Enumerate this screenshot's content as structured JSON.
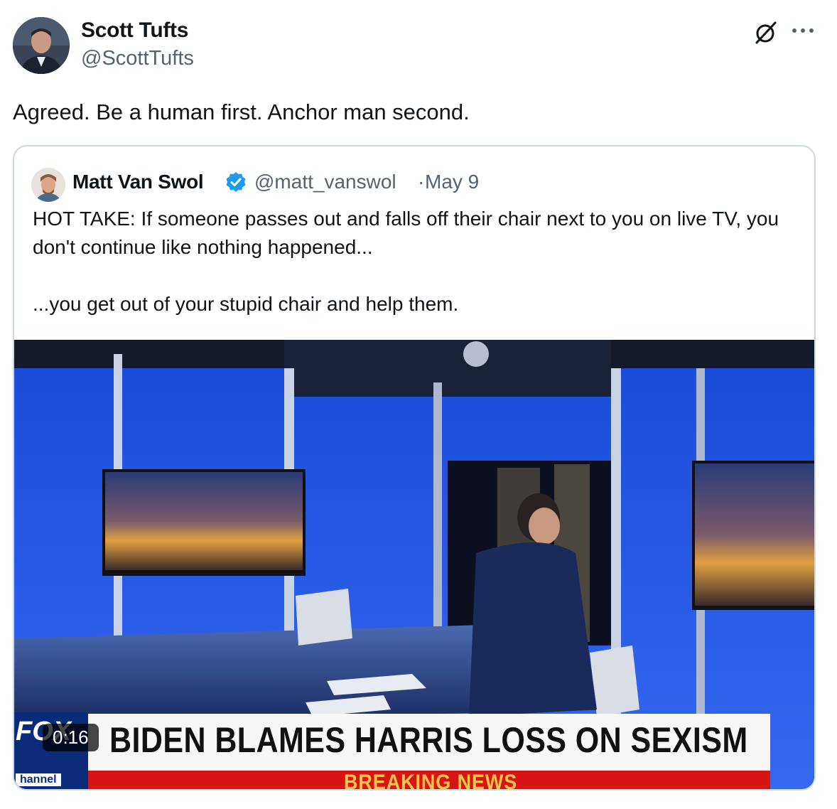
{
  "tweet": {
    "author_name": "Scott Tufts",
    "author_handle": "@ScottTufts",
    "text": "Agreed. Be a human first. Anchor man second.",
    "icons": {
      "grok": "grok-slash-icon",
      "more": "more-dots-icon"
    }
  },
  "quoted": {
    "author_name": "Matt Van Swol",
    "author_handle": "@matt_vanswol",
    "separator": "·",
    "date": "May 9",
    "text_line1": "HOT TAKE: If someone passes out and falls off their chair next to you on live TV, you don't continue like nothing happened...",
    "text_line2": "...you get out of your stupid chair and help them.",
    "verified_color": "#1d9bf0"
  },
  "video": {
    "duration": "0:16",
    "chyron": "BIDEN BLAMES HARRIS LOSS ON SEXISM",
    "breaking": "BREAKING NEWS",
    "logo": "FOX",
    "logo_sub": "hannel"
  }
}
